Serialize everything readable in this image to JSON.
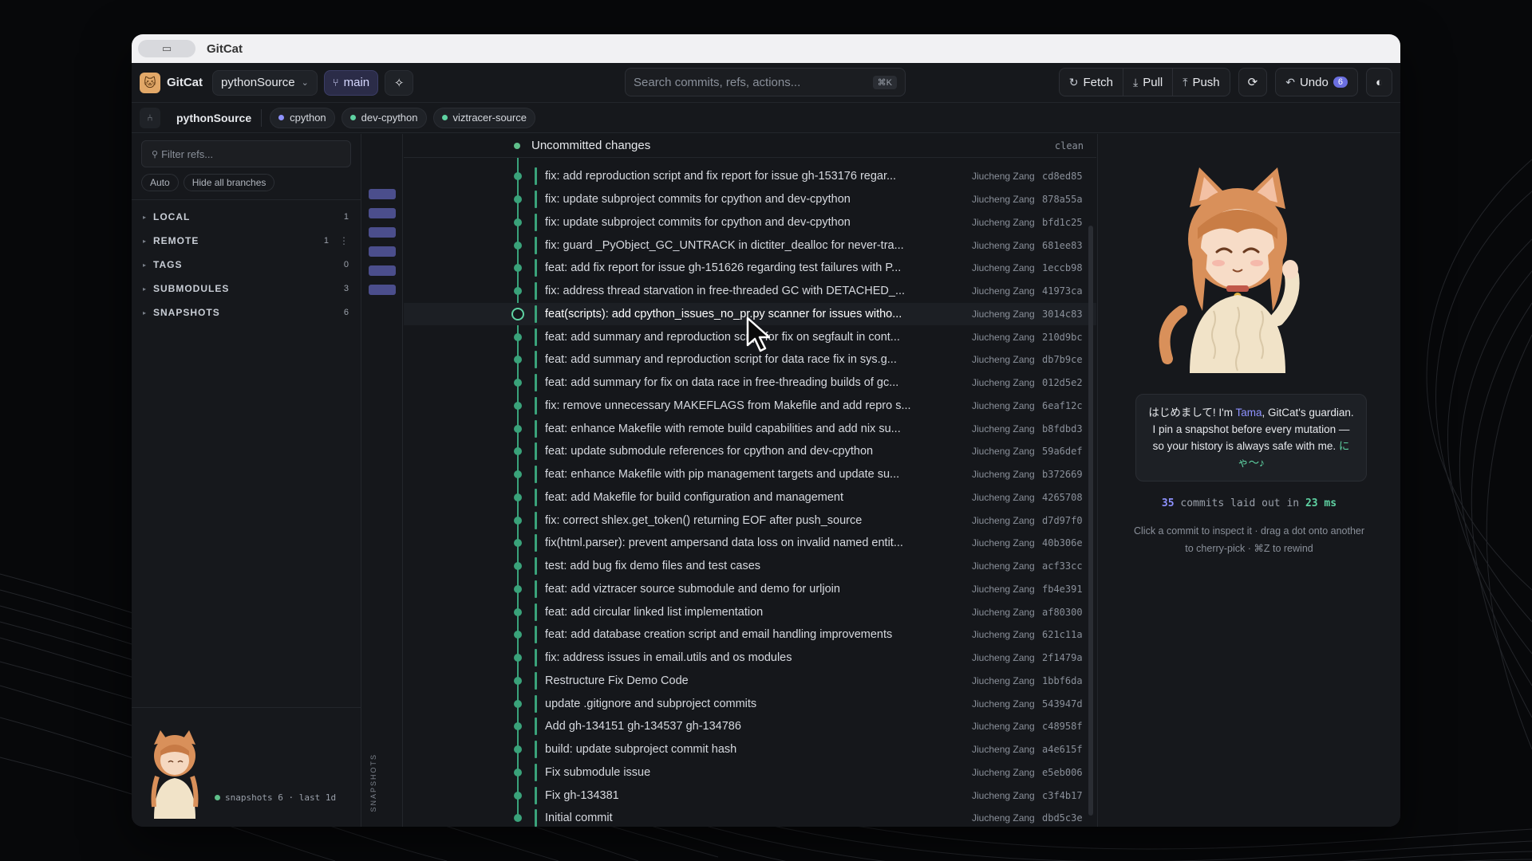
{
  "window": {
    "title": "GitCat"
  },
  "toolbar": {
    "app_name": "GitCat",
    "repo_select": "pythonSource",
    "branch": "main",
    "search_placeholder": "Search commits, refs, actions...",
    "search_shortcut": "⌘K",
    "fetch": "Fetch",
    "pull": "Pull",
    "push": "Push",
    "undo": "Undo",
    "undo_count": "6"
  },
  "repobar": {
    "repo": "pythonSource",
    "chips": [
      {
        "label": "cpython",
        "color": "#8e92ff"
      },
      {
        "label": "dev-cpython",
        "color": "#5fd3a3"
      },
      {
        "label": "viztracer-source",
        "color": "#5fd3a3"
      }
    ]
  },
  "sidebar": {
    "filter_placeholder": "Filter refs...",
    "auto": "Auto",
    "hide_all": "Hide all branches",
    "sections": [
      {
        "label": "LOCAL",
        "count": "1"
      },
      {
        "label": "REMOTE",
        "count": "1"
      },
      {
        "label": "TAGS",
        "count": "0"
      },
      {
        "label": "SUBMODULES",
        "count": "3"
      },
      {
        "label": "SNAPSHOTS",
        "count": "6"
      }
    ],
    "snapshots_status": "snapshots 6 · last 1d"
  },
  "snapshots_column": {
    "label": "SNAPSHOTS"
  },
  "graph": {
    "uncommitted": "Uncommitted changes",
    "uncommitted_state": "clean",
    "commits": [
      {
        "msg": "fix: add reproduction script and fix report for issue gh-153176 regar...",
        "author": "Jiucheng Zang",
        "hash": "cd8ed85"
      },
      {
        "msg": "fix: update subproject commits for cpython and dev-cpython",
        "author": "Jiucheng Zang",
        "hash": "878a55a"
      },
      {
        "msg": "fix: update subproject commits for cpython and dev-cpython",
        "author": "Jiucheng Zang",
        "hash": "bfd1c25"
      },
      {
        "msg": "fix: guard _PyObject_GC_UNTRACK in dictiter_dealloc for never-tra...",
        "author": "Jiucheng Zang",
        "hash": "681ee83"
      },
      {
        "msg": "feat: add fix report for issue gh-151626 regarding test failures with P...",
        "author": "Jiucheng Zang",
        "hash": "1eccb98"
      },
      {
        "msg": "fix: address thread starvation in free-threaded GC with DETACHED_...",
        "author": "Jiucheng Zang",
        "hash": "41973ca"
      },
      {
        "msg": "feat(scripts): add cpython_issues_no_pr.py scanner for issues witho...",
        "author": "Jiucheng Zang",
        "hash": "3014c83"
      },
      {
        "msg": "feat: add summary and reproduction script for fix on segfault in cont...",
        "author": "Jiucheng Zang",
        "hash": "210d9bc"
      },
      {
        "msg": "feat: add summary and reproduction script for data race fix in sys.g...",
        "author": "Jiucheng Zang",
        "hash": "db7b9ce"
      },
      {
        "msg": "feat: add summary for fix on data race in free-threading builds of gc...",
        "author": "Jiucheng Zang",
        "hash": "012d5e2"
      },
      {
        "msg": "fix: remove unnecessary MAKEFLAGS from Makefile and add repro s...",
        "author": "Jiucheng Zang",
        "hash": "6eaf12c"
      },
      {
        "msg": "feat: enhance Makefile with remote build capabilities and add nix su...",
        "author": "Jiucheng Zang",
        "hash": "b8fdbd3"
      },
      {
        "msg": "feat: update submodule references for cpython and dev-cpython",
        "author": "Jiucheng Zang",
        "hash": "59a6def"
      },
      {
        "msg": "feat: enhance Makefile with pip management targets and update su...",
        "author": "Jiucheng Zang",
        "hash": "b372669"
      },
      {
        "msg": "feat: add Makefile for build configuration and management",
        "author": "Jiucheng Zang",
        "hash": "4265708"
      },
      {
        "msg": "fix: correct shlex.get_token() returning EOF after push_source",
        "author": "Jiucheng Zang",
        "hash": "d7d97f0"
      },
      {
        "msg": "fix(html.parser): prevent ampersand data loss on invalid named entit...",
        "author": "Jiucheng Zang",
        "hash": "40b306e"
      },
      {
        "msg": "test: add bug fix demo files and test cases",
        "author": "Jiucheng Zang",
        "hash": "acf33cc"
      },
      {
        "msg": "feat: add viztracer source submodule and demo for urljoin",
        "author": "Jiucheng Zang",
        "hash": "fb4e391"
      },
      {
        "msg": "feat: add circular linked list implementation",
        "author": "Jiucheng Zang",
        "hash": "af80300"
      },
      {
        "msg": "feat: add database creation script and email handling improvements",
        "author": "Jiucheng Zang",
        "hash": "621c11a"
      },
      {
        "msg": "fix: address issues in email.utils and os modules",
        "author": "Jiucheng Zang",
        "hash": "2f1479a"
      },
      {
        "msg": "Restructure Fix Demo Code",
        "author": "Jiucheng Zang",
        "hash": "1bbf6da"
      },
      {
        "msg": "update .gitignore and subproject commits",
        "author": "Jiucheng Zang",
        "hash": "543947d"
      },
      {
        "msg": "Add gh-134151 gh-134537 gh-134786",
        "author": "Jiucheng Zang",
        "hash": "c48958f"
      },
      {
        "msg": "build: update subproject commit hash",
        "author": "Jiucheng Zang",
        "hash": "a4e615f"
      },
      {
        "msg": "Fix submodule issue",
        "author": "Jiucheng Zang",
        "hash": "e5eb006"
      },
      {
        "msg": "Fix gh-134381",
        "author": "Jiucheng Zang",
        "hash": "c3f4b17"
      },
      {
        "msg": "Initial commit",
        "author": "Jiucheng Zang",
        "hash": "dbd5c3e"
      }
    ],
    "selected_index": 6
  },
  "right_panel": {
    "greeting_pre": "はじめまして! I'm ",
    "greeting_name": "Tama",
    "greeting_post": ", GitCat's guardian. I pin a snapshot before every mutation — so your history is always safe with me. ",
    "greeting_nya": "にゃ〜♪",
    "stats_count": "35",
    "stats_text": " commits laid out in ",
    "stats_ms": "23 ms",
    "hint": "Click a commit to inspect it · drag a dot onto another to cherry-pick · ⌘Z to rewind"
  }
}
